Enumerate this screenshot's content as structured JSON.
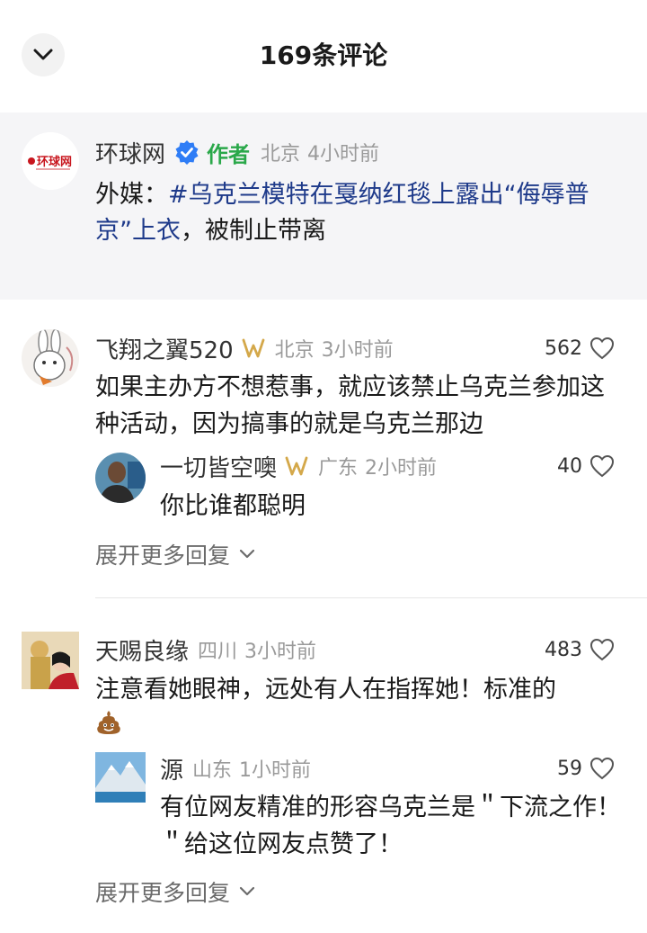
{
  "header": {
    "title": "169条评论"
  },
  "post": {
    "author": "环球网",
    "author_tag": "作者",
    "location": "北京",
    "time": "4小时前",
    "text_prefix": "外媒：",
    "hashtag": "#乌克兰模特在戛纳红毯上露出“侮辱普京”上衣",
    "text_suffix": "，被制止带离",
    "avatar_logo": "环球网"
  },
  "comments": [
    {
      "name": "飞翔之翼520",
      "location": "北京",
      "time": "3小时前",
      "likes": "562",
      "text": "如果主办方不想惹事，就应该禁止乌克兰参加这种活动，因为搞事的就是乌克兰那边",
      "reply": {
        "name": "一切皆空噢",
        "location": "广东",
        "time": "2小时前",
        "likes": "40",
        "text": "你比谁都聪明"
      },
      "expand_label": "展开更多回复"
    },
    {
      "name": "天赐良缘",
      "location": "四川",
      "time": "3小时前",
      "likes": "483",
      "text": "注意看她眼神，远处有人在指挥她！标准的",
      "emoji": "poo-emoji",
      "reply": {
        "name": "源",
        "location": "山东",
        "time": "1小时前",
        "likes": "59",
        "text": "有位网友精准的形容乌克兰是＂下流之作！＂给这位网友点赞了！"
      },
      "expand_label": "展开更多回复"
    }
  ],
  "colors": {
    "accent_green": "#2aa84a",
    "hashtag_blue": "#1e3a8a",
    "gold_badge": "#d4a84a",
    "verified_blue": "#2f7df6"
  }
}
